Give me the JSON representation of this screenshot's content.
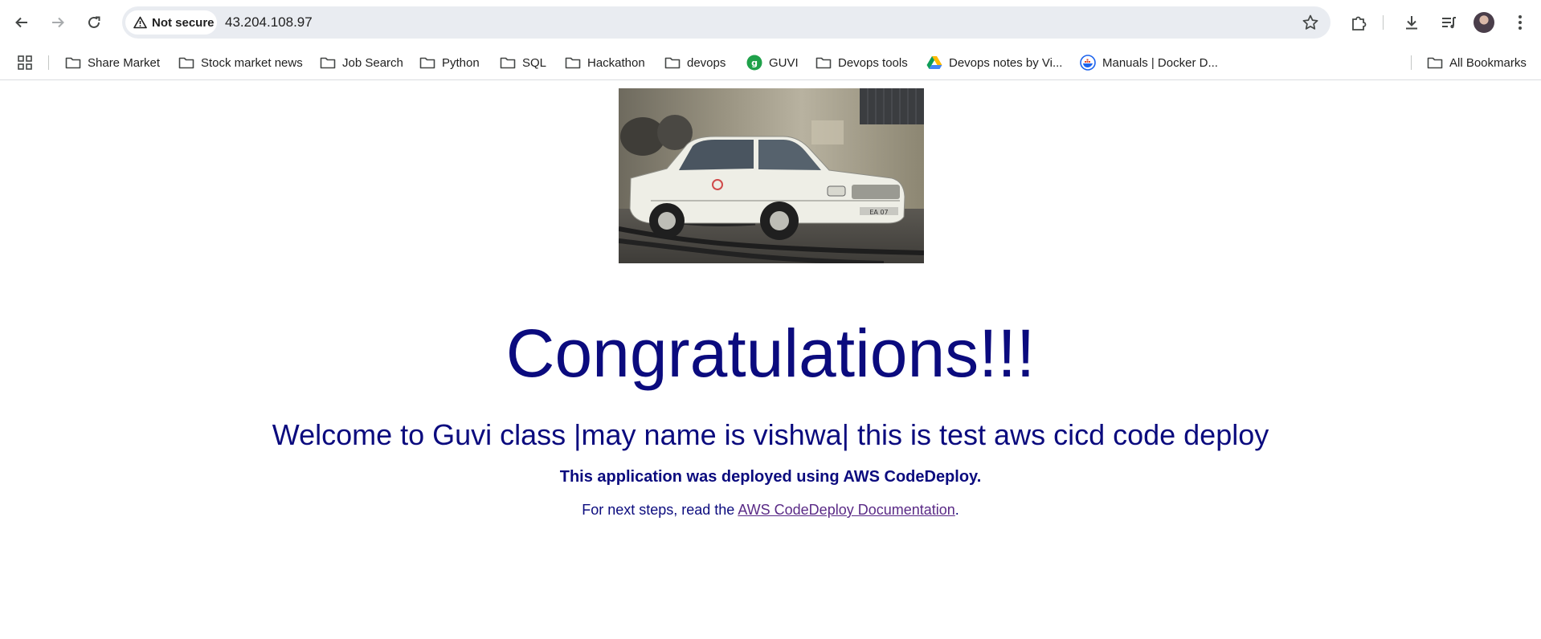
{
  "browser": {
    "security_label": "Not secure",
    "url": "43.204.108.97"
  },
  "bookmarks": {
    "items": [
      {
        "label": "Share Market",
        "icon": "folder-icon"
      },
      {
        "label": "Stock market news",
        "icon": "folder-icon"
      },
      {
        "label": "Job Search",
        "icon": "folder-icon"
      },
      {
        "label": "Python",
        "icon": "folder-icon"
      },
      {
        "label": "SQL",
        "icon": "folder-icon"
      },
      {
        "label": "Hackathon",
        "icon": "folder-icon"
      },
      {
        "label": "devops",
        "icon": "folder-icon"
      },
      {
        "label": "GUVI",
        "icon": "guvi-logo-icon"
      },
      {
        "label": "Devops tools",
        "icon": "folder-icon"
      },
      {
        "label": "Devops notes by Vi...",
        "icon": "google-drive-icon"
      },
      {
        "label": "Manuals | Docker D...",
        "icon": "docker-icon"
      }
    ],
    "all_bookmarks": "All Bookmarks"
  },
  "page": {
    "headline": "Congratulations!!!",
    "welcome": "Welcome to Guvi class |may name is vishwa| this is test aws cicd code deploy",
    "deployed": "This application was deployed using AWS CodeDeploy.",
    "next_steps_prefix": "For next steps, read the ",
    "doc_link": "AWS CodeDeploy Documentation",
    "next_steps_suffix": "."
  },
  "colors": {
    "heading_text": "#0b0b7e",
    "link": "#5a2a86",
    "guvi_green": "#1fa14a"
  }
}
